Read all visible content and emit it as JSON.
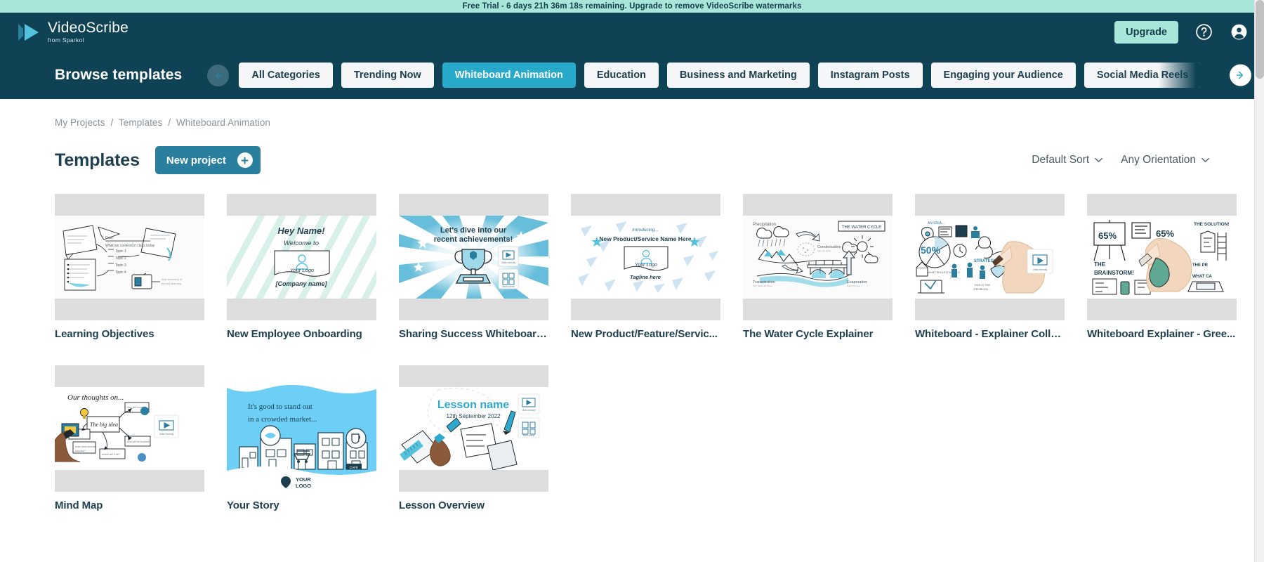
{
  "banner": {
    "text": "Free Trial - 6 days 21h 36m 18s remaining. Upgrade to remove VideoScribe watermarks",
    "bg_color": "#a8e6da"
  },
  "header": {
    "logo_name": "VideoScribe",
    "logo_sub": "from Sparkol",
    "upgrade_label": "Upgrade",
    "help_icon": "help-circle-icon",
    "account_icon": "account-circle-icon",
    "bg_color": "#0f4254"
  },
  "catnav": {
    "title": "Browse templates",
    "prev_icon": "arrow-left-icon",
    "next_icon": "arrow-right-icon",
    "active_color": "#27a9c9",
    "categories": [
      {
        "label": "All Categories",
        "active": false
      },
      {
        "label": "Trending Now",
        "active": false
      },
      {
        "label": "Whiteboard Animation",
        "active": true
      },
      {
        "label": "Education",
        "active": false
      },
      {
        "label": "Business and Marketing",
        "active": false
      },
      {
        "label": "Instagram Posts",
        "active": false
      },
      {
        "label": "Engaging your Audience",
        "active": false
      },
      {
        "label": "Social Media Reels",
        "active": false
      }
    ]
  },
  "breadcrumb": {
    "items": [
      "My Projects",
      "Templates",
      "Whiteboard Animation"
    ],
    "separator": "/"
  },
  "toolbar": {
    "page_title": "Templates",
    "new_project_label": "New project",
    "plus_icon": "plus-icon",
    "sort_label": "Default Sort",
    "orientation_label": "Any Orientation",
    "chevron_icon": "chevron-down-icon"
  },
  "templates": [
    {
      "label": "Learning Objectives",
      "art": "sticky-notes-lesson-plan",
      "art_texts": [
        "Date:",
        "What we covered in class today",
        "Topic 1",
        "Topic 2",
        "Topic 3",
        "Topic 4"
      ]
    },
    {
      "label": "New Employee Onboarding",
      "art": "welcome-logo-card",
      "art_texts": [
        "Hey Name!",
        "Welcome to",
        "Your Logo",
        "[Company name]"
      ]
    },
    {
      "label": "Sharing Success Whiteboard ...",
      "art": "trophy-starburst",
      "art_texts": [
        "Let's dive into our",
        "recent achievements!",
        "Video friendly",
        "Multi-scene"
      ]
    },
    {
      "label": "New Product/Feature/Servic...",
      "art": "product-launch-confetti",
      "art_texts": [
        "Introducing...",
        "New Product/Service Name Here",
        "Your Logo",
        "Tagline here"
      ]
    },
    {
      "label": "The Water Cycle Explainer",
      "art": "water-cycle-diagram",
      "art_texts": [
        "Precipitation",
        "THE WATER CYCLE",
        "Condensation",
        "Evaporation",
        "Transpiration"
      ]
    },
    {
      "label": "Whiteboard - Explainer Collage",
      "art": "hand-drawing-collage",
      "art_texts": [
        "AN IDEA...",
        "50%",
        "STRATEGIZE",
        "THIS IS THE PROBLEM...",
        "Video friendly"
      ]
    },
    {
      "label": "Whiteboard Explainer - Gree...",
      "art": "hand-drawing-brainstorm",
      "art_texts": [
        "65%",
        "THE BRAINSTORM!",
        "THE SOLUTION!",
        "WHAT CAN"
      ]
    },
    {
      "label": "Mind Map",
      "art": "mind-map-hand",
      "art_texts": [
        "Our thoughts on...",
        "The big idea",
        "how will it work?",
        "Video friendly"
      ]
    },
    {
      "label": "Your Story",
      "art": "storefront-blue",
      "art_texts": [
        "It's good to stand out",
        "in a crowded market...",
        "YOUR LOGO"
      ]
    },
    {
      "label": "Lesson Overview",
      "art": "lesson-desk-items",
      "art_texts": [
        "Lesson name",
        "12th September 2022",
        "Video friendly",
        "Multi-scene"
      ]
    }
  ]
}
